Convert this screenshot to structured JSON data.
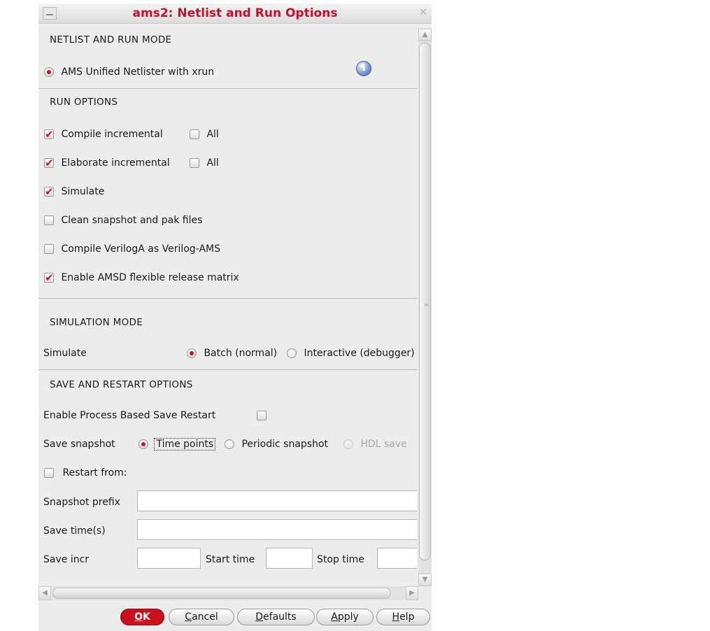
{
  "window": {
    "title": "ams2: Netlist and Run Options"
  },
  "netlist": {
    "header": "NETLIST AND RUN MODE",
    "option_label": "AMS Unified Netlister with xrun",
    "info_glyph": "i"
  },
  "run_options": {
    "header": "RUN OPTIONS",
    "compile_incremental": "Compile incremental",
    "elaborate_incremental": "Elaborate incremental",
    "all_label": "All",
    "simulate": "Simulate",
    "clean_snapshot": "Clean snapshot and pak files",
    "compile_veriloga": "Compile VerilogA as Verilog-AMS",
    "enable_amsd": "Enable AMSD flexible release matrix"
  },
  "simulation_mode": {
    "header": "SIMULATION MODE",
    "label": "Simulate",
    "batch": "Batch (normal)",
    "interactive": "Interactive (debugger)"
  },
  "save_restart": {
    "header": "SAVE AND RESTART OPTIONS",
    "enable_process": "Enable Process Based Save Restart",
    "save_snapshot": "Save snapshot",
    "time_points": "Time points",
    "periodic_snapshot": "Periodic snapshot",
    "hdl_save": "HDL save",
    "restart_from": "Restart from:",
    "snapshot_prefix": "Snapshot prefix",
    "save_times": "Save time(s)",
    "save_incr": "Save incr",
    "start_time": "Start time",
    "stop_time": "Stop time"
  },
  "buttons": {
    "ok_u": "O",
    "ok_rest": "K",
    "cancel_u": "C",
    "cancel_rest": "ancel",
    "defaults_u": "D",
    "defaults_rest": "efaults",
    "apply_u": "A",
    "apply_rest": "pply",
    "help_u": "H",
    "help_rest": "elp"
  },
  "colors": {
    "accent_red": "#c8102e",
    "check_red": "#d0101c",
    "window_bg": "#ececec"
  },
  "icons": [
    "minimize-icon",
    "close-icon",
    "info-icon",
    "scroll-up-icon",
    "scroll-down-icon",
    "scroll-left-icon",
    "scroll-right-icon"
  ]
}
